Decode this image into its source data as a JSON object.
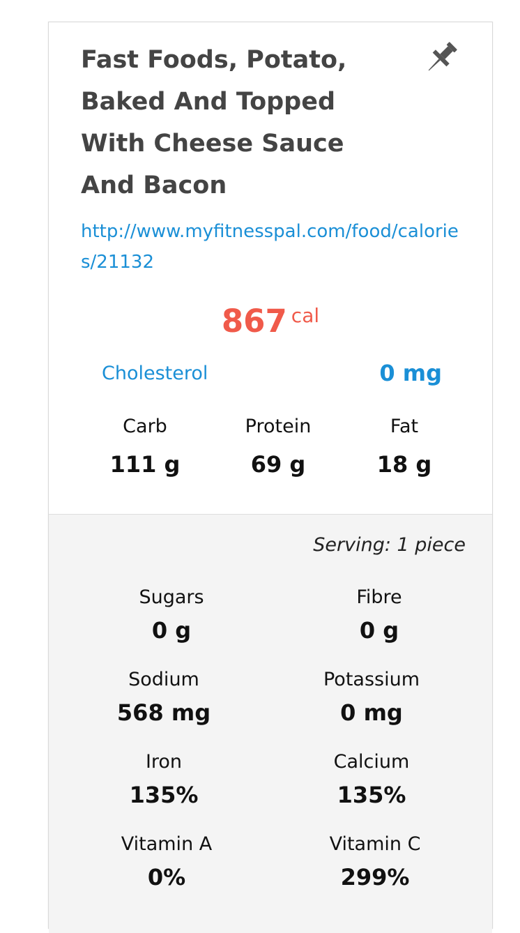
{
  "food": {
    "title": "Fast Foods, Potato, Baked And Topped With Cheese Sauce And Bacon",
    "pin_icon": "pin-icon",
    "url": "http://www.myfitnesspal.com/food/calories/21132",
    "calories": "867",
    "calories_unit": "cal",
    "highlight_nutrient": {
      "label": "Cholesterol",
      "value": "0 mg"
    },
    "macros": [
      {
        "label": "Carb",
        "value": "111 g"
      },
      {
        "label": "Protein",
        "value": "69 g"
      },
      {
        "label": "Fat",
        "value": "18 g"
      }
    ]
  },
  "details": {
    "serving": "Serving: 1 piece",
    "nutrients": [
      {
        "label": "Sugars",
        "value": "0 g"
      },
      {
        "label": "Fibre",
        "value": "0 g"
      },
      {
        "label": "Sodium",
        "value": "568 mg"
      },
      {
        "label": "Potassium",
        "value": "0 mg"
      },
      {
        "label": "Iron",
        "value": "135%"
      },
      {
        "label": "Calcium",
        "value": "135%"
      },
      {
        "label": "Vitamin A",
        "value": "0%"
      },
      {
        "label": "Vitamin C",
        "value": "299%"
      }
    ]
  },
  "colors": {
    "title": "#444444",
    "link": "#1a8fd6",
    "calories": "#f05a4a",
    "details_background": "#f4f4f4"
  }
}
